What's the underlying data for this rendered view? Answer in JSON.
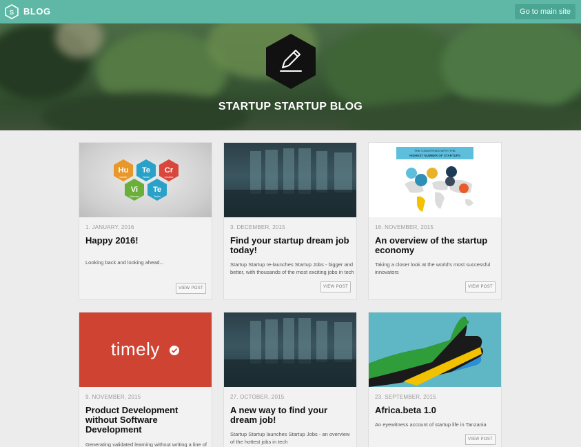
{
  "header": {
    "logo_text": "S",
    "brand": "BLOG",
    "main_site_label": "Go to main site"
  },
  "hero": {
    "title": "STARTUP STARTUP BLOG",
    "icon": "pencil-icon"
  },
  "posts": [
    {
      "date": "1. JANUARY, 2016",
      "title": "Happy 2016!",
      "excerpt": "Looking back and looking ahead...",
      "button": "VIEW POST",
      "thumb": {
        "hexes": [
          {
            "sym": "Hu",
            "sub": "Hustler",
            "color": "#e8982a"
          },
          {
            "sym": "Te",
            "sub": "Techie",
            "color": "#2aa1c9"
          },
          {
            "sym": "Cr",
            "sub": "Creative",
            "color": "#d9473c"
          },
          {
            "sym": "Vi",
            "sub": "Visionary",
            "color": "#6aaf3a"
          },
          {
            "sym": "Te",
            "sub": "Techie",
            "color": "#2aa1c9"
          }
        ]
      }
    },
    {
      "date": "3. DECEMBER, 2015",
      "title": "Find your startup dream job today!",
      "excerpt": "Startup Startup re-launches Startup Jobs - bigger and better, with thousands of the most exciting jobs in tech",
      "button": "VIEW POST"
    },
    {
      "date": "16. NOVEMBER, 2015",
      "title": "An overview of the startup economy",
      "excerpt": "Taking a closer look at the world's most successful innovators",
      "button": "VIEW POST",
      "thumb": {
        "banner_line1": "THE COUNTRIES WITH THE",
        "banner_line2": "HIGHEST NUMBER OF STARTUPS"
      }
    },
    {
      "date": "9. NOVEMBER, 2015",
      "title": "Product Development without Software Development",
      "excerpt": "Generating validated learning without writing a line of",
      "button": "VIEW POST",
      "thumb": {
        "logo_text": "timely"
      }
    },
    {
      "date": "27. OCTOBER, 2015",
      "title": "A new way to find your dream job!",
      "excerpt": "Startup Startup launches Startup Jobs - an overview of the hottest jobs in tech",
      "button": "VIEW POST"
    },
    {
      "date": "23. SEPTEMBER, 2015",
      "title": "Africa.beta 1.0",
      "excerpt": "An eyewitness account of startup life in Tanzania",
      "button": "VIEW POST"
    }
  ],
  "colors": {
    "topbar": "#5fb8a5",
    "accent_button": "#4aa692",
    "page_bg": "#ececec"
  }
}
